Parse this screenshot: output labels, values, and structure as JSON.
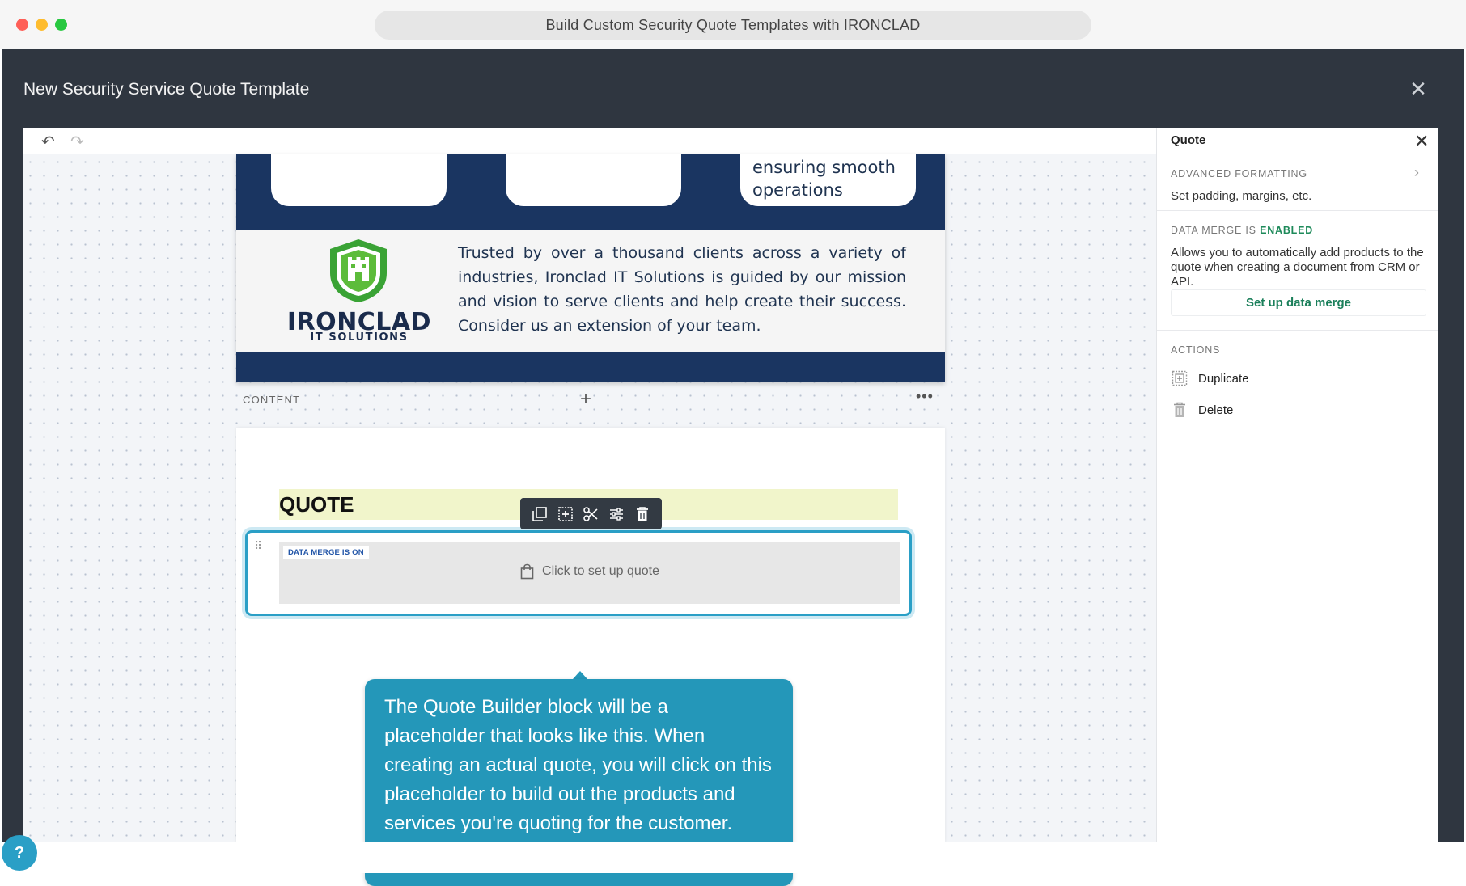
{
  "browser": {
    "tab_title": "Build Custom Security Quote Templates with IRONCLAD"
  },
  "modal": {
    "title": "New Security Service Quote Template",
    "close_icon": "close-icon"
  },
  "editor": {
    "undo_icon": "undo-icon",
    "redo_icon": "redo-icon",
    "top_section": {
      "card_text": "ensuring smooth operations",
      "logo_name": "IRONCLAD",
      "logo_sub": "IT SOLUTIONS",
      "about_text": "Trusted by over a thousand clients across a variety of industries, Ironclad IT Solutions is guided by our mission and vision to serve clients and help create their success. Consider us an extension of your team."
    },
    "content_bar": {
      "label": "CONTENT",
      "add": "+",
      "more": "•••"
    },
    "quote_block": {
      "heading": "QUOTE",
      "badge": "DATA MERGE IS ON",
      "placeholder": "Click to set up quote",
      "toolbar_icons": [
        "copy-icon",
        "add-block-icon",
        "scissors-icon",
        "settings-icon",
        "trash-icon"
      ]
    },
    "tooltip": {
      "text": "The Quote Builder block will be a placeholder that looks like this. When creating an actual quote, you will click on this placeholder to build out the products and services you're quoting for the customer."
    }
  },
  "panel": {
    "title": "Quote",
    "advanced": {
      "label": "ADVANCED FORMATTING",
      "desc": "Set padding, margins, etc."
    },
    "data_merge": {
      "label_prefix": "DATA MERGE IS ",
      "label_status": "ENABLED",
      "desc": "Allows you to automatically add products to the quote when creating a document from CRM or API.",
      "button": "Set up data merge"
    },
    "actions": {
      "label": "ACTIONS",
      "items": [
        {
          "label": "Duplicate",
          "icon": "duplicate-icon"
        },
        {
          "label": "Delete",
          "icon": "trash-icon"
        }
      ]
    }
  },
  "help": {
    "label": "?"
  },
  "colors": {
    "navy": "#1a3561",
    "accent": "#2a9fc6",
    "tooltip": "#2497b9",
    "enabled": "#1e8a5a",
    "quote_highlight": "#f1f5cb"
  }
}
